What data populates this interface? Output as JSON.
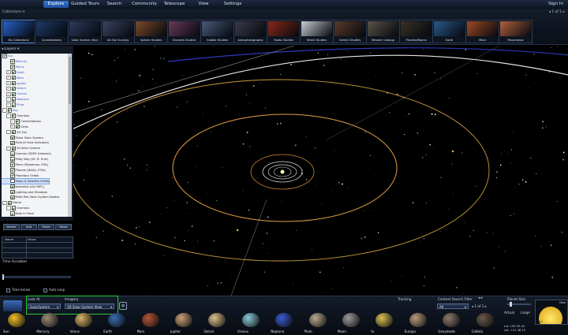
{
  "menu": {
    "items": [
      "Explore",
      "Guided Tours",
      "Search",
      "Community",
      "Telescope",
      "View",
      "Settings"
    ],
    "sign_in": "Sign In"
  },
  "collections": {
    "label": "Collections",
    "pager": "1 of 1",
    "items": [
      {
        "label": "My Collections",
        "color": "#2a62c8"
      },
      {
        "label": "Constellations",
        "color": "#1f3b66"
      },
      {
        "label": "Solar System (Sky)",
        "color": "#2b3b5c"
      },
      {
        "label": "All-Sky Surveys",
        "color": "#3a4460"
      },
      {
        "label": "Spitzer Studies",
        "color": "#7a4a2a"
      },
      {
        "label": "Chandra Studies",
        "color": "#6a3a5a"
      },
      {
        "label": "Hubble Studies",
        "color": "#4a5a7a"
      },
      {
        "label": "Astrophotography",
        "color": "#3a3a48"
      },
      {
        "label": "Radio Studies",
        "color": "#8a2a1a"
      },
      {
        "label": "NOAO Studies",
        "color": "#c8ccd4"
      },
      {
        "label": "Gemini Studies",
        "color": "#5a3a2a"
      },
      {
        "label": "Messier Catalog",
        "color": "#5a5248"
      },
      {
        "label": "Planets/Moons",
        "color": "#3a3024"
      },
      {
        "label": "Earth",
        "color": "#2a5a8a"
      },
      {
        "label": "Mars",
        "color": "#a04a24"
      },
      {
        "label": "Panoramas",
        "color": "#b0603a"
      }
    ]
  },
  "layers": {
    "title": "Layers",
    "tree": [
      {
        "label": "Sun",
        "indent": 0,
        "checked": true,
        "expander": "",
        "blue": true
      },
      {
        "label": "Mercury",
        "indent": 2,
        "checked": true,
        "expander": "",
        "blue": true
      },
      {
        "label": "Venus",
        "indent": 2,
        "checked": true,
        "expander": "",
        "blue": true
      },
      {
        "label": "Earth",
        "indent": 1,
        "checked": true,
        "expander": "+",
        "blue": true
      },
      {
        "label": "Mars",
        "indent": 1,
        "checked": true,
        "expander": "+",
        "blue": true
      },
      {
        "label": "Jupiter",
        "indent": 1,
        "checked": true,
        "expander": "+",
        "blue": true
      },
      {
        "label": "Saturn",
        "indent": 1,
        "checked": true,
        "expander": "+",
        "blue": true
      },
      {
        "label": "Uranus",
        "indent": 1,
        "checked": true,
        "expander": "+",
        "blue": true
      },
      {
        "label": "Neptune",
        "indent": 1,
        "checked": true,
        "expander": "+",
        "blue": true
      },
      {
        "label": "Pluto",
        "indent": 1,
        "checked": true,
        "expander": "+",
        "blue": true
      },
      {
        "label": "Sky",
        "indent": 0,
        "checked": true,
        "expander": "-",
        "blue": true
      },
      {
        "label": "Overlays",
        "indent": 1,
        "checked": true,
        "expander": "-",
        "blue": false
      },
      {
        "label": "Constellations",
        "indent": 2,
        "checked": true,
        "expander": "+",
        "blue": false
      },
      {
        "label": "Grids",
        "indent": 2,
        "checked": true,
        "expander": "+",
        "blue": false
      },
      {
        "label": "2D Sky",
        "indent": 1,
        "checked": true,
        "expander": "-",
        "blue": false
      },
      {
        "label": "Show Solar System",
        "indent": 2,
        "checked": true,
        "expander": "",
        "blue": false
      },
      {
        "label": "Field of View Indicators",
        "indent": 2,
        "checked": true,
        "expander": "",
        "blue": false
      },
      {
        "label": "3d Solar System",
        "indent": 1,
        "checked": true,
        "expander": "-",
        "blue": false
      },
      {
        "label": "Cosmos (SDSS Galaxies)",
        "indent": 2,
        "checked": true,
        "expander": "",
        "blue": false
      },
      {
        "label": "Milky Way (Dr. R. Hurt)",
        "indent": 2,
        "checked": true,
        "expander": "",
        "blue": false
      },
      {
        "label": "Stars (Hipparcos, ESA)",
        "indent": 2,
        "checked": true,
        "expander": "",
        "blue": false
      },
      {
        "label": "Planets (NASA, ETAL)",
        "indent": 2,
        "checked": true,
        "expander": "",
        "blue": false
      },
      {
        "label": "Planetary Orbits",
        "indent": 2,
        "checked": true,
        "expander": "",
        "blue": false
      },
      {
        "label": "Moon & Satellite Orbits",
        "indent": 2,
        "checked": false,
        "expander": "",
        "blue": false,
        "highlight": true
      },
      {
        "label": "Asteroids (IAU MPC)",
        "indent": 2,
        "checked": true,
        "expander": "",
        "blue": false
      },
      {
        "label": "Lighting and Shadows",
        "indent": 2,
        "checked": true,
        "expander": "",
        "blue": false
      },
      {
        "label": "Multi-Res Solar System Bodies",
        "indent": 2,
        "checked": true,
        "expander": "",
        "blue": false
      },
      {
        "label": "Dome",
        "indent": 0,
        "checked": true,
        "expander": "-",
        "blue": false
      },
      {
        "label": "Overlays",
        "indent": 1,
        "checked": true,
        "expander": "-",
        "blue": false
      },
      {
        "label": "Fade In Hoch",
        "indent": 2,
        "checked": true,
        "expander": "",
        "blue": false
      }
    ],
    "buttons": [
      "Delete",
      "Add",
      "Paste",
      "Reset"
    ],
    "props_headers": [
      "Name",
      "Value"
    ]
  },
  "time": {
    "title": "Time Scrubber",
    "time_series": "Time Series",
    "auto_loop": "Auto Loop"
  },
  "bottom": {
    "look_at_label": "Look At",
    "look_at_value": "SolarSystem",
    "imagery_label": "Imagery",
    "imagery_value": "3D Solar System View",
    "tracking_label": "Tracking",
    "context_label": "Context Search Filter",
    "context_value": "All",
    "context_pager": "1 of 1",
    "planet_size_label": "Planet Size",
    "now_label": "Now",
    "actual_label": "Actual",
    "large_label": "Large",
    "size_value": 0.1,
    "lst_label": "Lst:",
    "lst_value": "150 59 44",
    "lat_label": "Lat:",
    "lat_value": "+21 48 20",
    "sun_label": "Sun",
    "planets": [
      {
        "label": "Sun",
        "color": "#f2c02a"
      },
      {
        "label": "Mercury",
        "color": "#9a8a72"
      },
      {
        "label": "Venus",
        "color": "#d9b36a"
      },
      {
        "label": "Earth",
        "color": "#3a6ab0"
      },
      {
        "label": "Mars",
        "color": "#b4553a"
      },
      {
        "label": "Jupiter",
        "color": "#c8a07a"
      },
      {
        "label": "Saturn",
        "color": "#d8c08a"
      },
      {
        "label": "Uranus",
        "color": "#8ac8d8"
      },
      {
        "label": "Neptune",
        "color": "#3a5ad0"
      },
      {
        "label": "Pluto",
        "color": "#b8a890"
      },
      {
        "label": "Moon",
        "color": "#9a9a9a"
      },
      {
        "label": "Io",
        "color": "#d8c050"
      },
      {
        "label": "Europa",
        "color": "#b89a7a"
      },
      {
        "label": "Ganymede",
        "color": "#8a7a6a"
      },
      {
        "label": "Callisto",
        "color": "#6a5a4a"
      }
    ]
  }
}
